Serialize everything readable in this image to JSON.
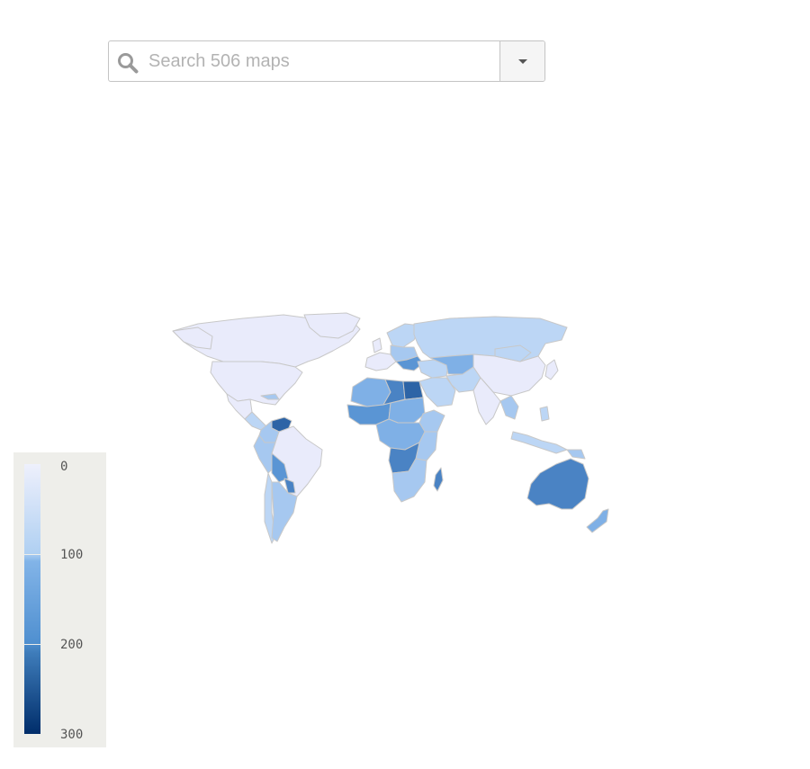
{
  "search": {
    "placeholder": "Search 506 maps",
    "icon": "search-icon",
    "dropdown_icon": "chevron-down-icon"
  },
  "legend": {
    "labels": [
      "0",
      "100",
      "200",
      "300"
    ],
    "min": 0,
    "max": 300,
    "colors": [
      "#eef0fc",
      "#b0d0f2",
      "#82b4e8",
      "#5090d0",
      "#3e7cba",
      "#002d6a"
    ]
  },
  "map": {
    "projection": "world",
    "border_color": "#c8c8c8",
    "land_colors": {
      "lightest": "#e9ebfb",
      "light": "#bcd6f5",
      "medium": "#a6c8f0",
      "strong": "#7fb0e6",
      "darker": "#5a95d4",
      "dark": "#4a83c4",
      "darkest": "#2d64a6"
    }
  }
}
